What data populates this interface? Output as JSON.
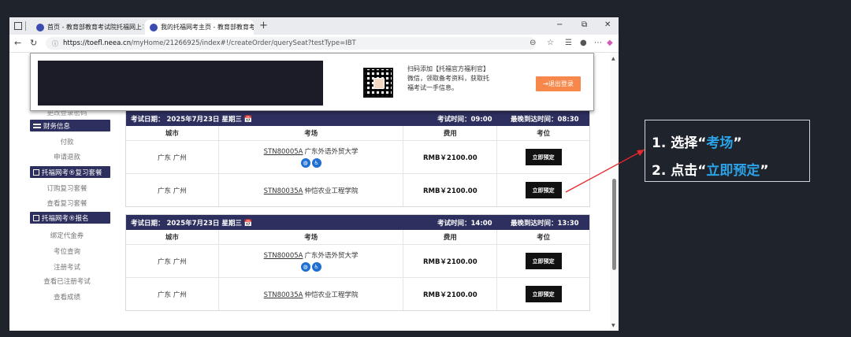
{
  "browser": {
    "tabs": [
      {
        "title": "首页 - 教育部教育考试院托福网上",
        "active": false
      },
      {
        "title": "我的托福网考主页 - 教育部教育考",
        "active": true
      }
    ],
    "new_tab": "+",
    "url_host": "https://toefl.neea.cn",
    "url_path": "/myHome/21266925/index#!/createOrder/querySeat?testType=IBT",
    "window_controls": [
      "−",
      "⧉",
      "✕"
    ]
  },
  "header": {
    "qr_text": "扫码添加【托福官方福利官】微信，领取备考资料，获取托福考试一手信息。",
    "logout_label": "⇥退出登录"
  },
  "sidebar": {
    "partial_top": "更改登录密码",
    "sections": [
      {
        "title": "财务信息",
        "items": [
          "付款",
          "申请退款"
        ]
      },
      {
        "title": "托福网考®复习套餐",
        "items": [
          "订购复习套餐",
          "查看复习套餐"
        ]
      },
      {
        "title": "托福网考®报名",
        "items": [
          "绑定代金券",
          "考位查询",
          "注册考试",
          "查看已注册考试",
          "查看成绩"
        ]
      }
    ]
  },
  "sessions": [
    {
      "date_label": "考试日期：  2025年7月23日 星期三 📅",
      "time_label": "考试时间：09:00",
      "arrive_label": "最晚到达时间：08:30",
      "columns": [
        "城市",
        "考场",
        "费用",
        "考位"
      ],
      "rows": [
        {
          "city": "广东 广州",
          "code": "STN80005A",
          "venue": "广东外语外贸大学",
          "badges": true,
          "fee": "RMB￥2100.00",
          "action": "立即预定"
        },
        {
          "city": "广东 广州",
          "code": "STN80035A",
          "venue": "仲恺农业工程学院",
          "badges": false,
          "fee": "RMB￥2100.00",
          "action": "立即预定"
        }
      ]
    },
    {
      "date_label": "考试日期：  2025年7月23日 星期三 📅",
      "time_label": "考试时间：14:00",
      "arrive_label": "最晚到达时间：13:30",
      "columns": [
        "城市",
        "考场",
        "费用",
        "考位"
      ],
      "rows": [
        {
          "city": "广东 广州",
          "code": "STN80005A",
          "venue": "广东外语外贸大学",
          "badges": true,
          "fee": "RMB￥2100.00",
          "action": "立即预定"
        },
        {
          "city": "广东 广州",
          "code": "STN80035A",
          "venue": "仲恺农业工程学院",
          "badges": false,
          "fee": "RMB￥2100.00",
          "action": "立即预定"
        }
      ]
    }
  ],
  "callout": {
    "line1_prefix": "1. 选择“",
    "line1_hl": "考场",
    "line1_suffix": "”",
    "line2_prefix": "2. 点击“",
    "line2_hl": "立即预定",
    "line2_suffix": "”",
    "highlight_color": "#2aa3e8",
    "arrow_color": "#e8262b"
  }
}
